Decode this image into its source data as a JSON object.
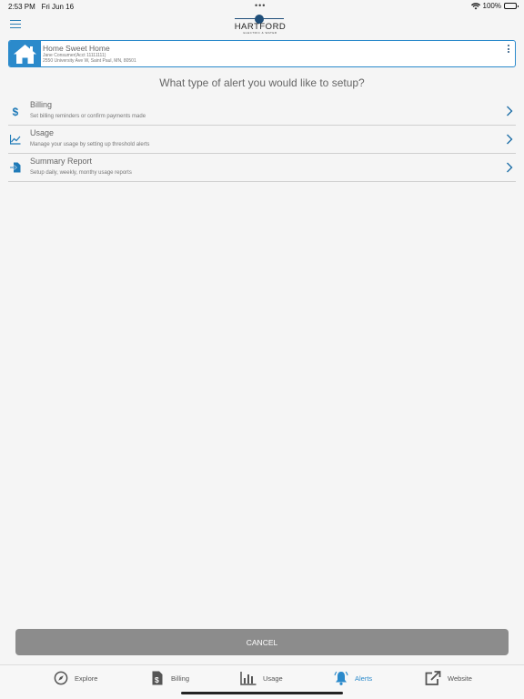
{
  "status_bar": {
    "time": "2:53 PM",
    "date": "Fri Jun 16",
    "dots": "•••",
    "battery": "100%"
  },
  "header": {
    "logo_text": "HARTFORD",
    "logo_sub": "ELECTRIC & WATER",
    "menu_icon": "hamburger-menu-icon"
  },
  "account": {
    "name": "Home Sweet Home",
    "owner": "Jane Consumer(Acct 11111111)",
    "address": "2550 University Ave W, Saint Paul, MN, 80501",
    "icon": "house-icon"
  },
  "question": "What type of alert you would like to setup?",
  "options": [
    {
      "title": "Billing",
      "subtitle": "Set billing reminders or confirm payments made",
      "icon": "dollar-icon"
    },
    {
      "title": "Usage",
      "subtitle": "Manage your usage by setting up threshold alerts",
      "icon": "line-chart-icon"
    },
    {
      "title": "Summary Report",
      "subtitle": "Setup daily, weekly, monthy usage reports",
      "icon": "file-import-icon"
    }
  ],
  "cancel_label": "CANCEL",
  "tabs": [
    {
      "label": "Explore",
      "icon": "compass-icon"
    },
    {
      "label": "Billing",
      "icon": "bill-icon"
    },
    {
      "label": "Usage",
      "icon": "bar-chart-icon"
    },
    {
      "label": "Alerts",
      "icon": "bell-icon",
      "active": true
    },
    {
      "label": "Website",
      "icon": "external-link-icon"
    }
  ],
  "colors": {
    "accent": "#2b8acb",
    "brand_dark": "#1f4e79",
    "cancel": "#8c8c8c"
  }
}
